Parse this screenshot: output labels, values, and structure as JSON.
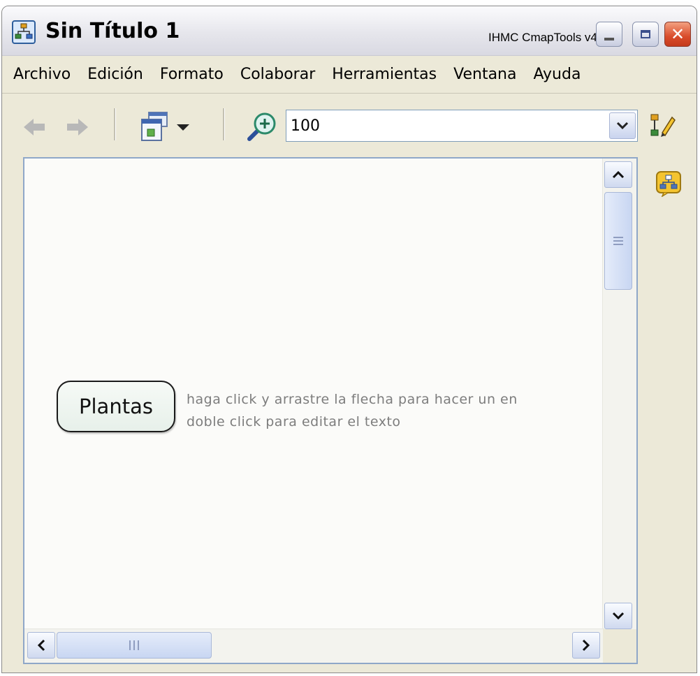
{
  "window": {
    "title": "Sin Título 1",
    "app_name": "IHMC CmapTools v4"
  },
  "menu": {
    "items": [
      "Archivo",
      "Edición",
      "Formato",
      "Colaborar",
      "Herramientas",
      "Ventana",
      "Ayuda"
    ]
  },
  "toolbar": {
    "zoom_value": "100"
  },
  "canvas": {
    "concept_label": "Plantas",
    "hint_line1": "haga click y arrastre la flecha para hacer un en",
    "hint_line2": "doble click para editar el texto"
  },
  "colors": {
    "window_bg": "#ECE9D8",
    "close_button": "#D94C2B",
    "canvas_bg": "#FBFBF9"
  }
}
